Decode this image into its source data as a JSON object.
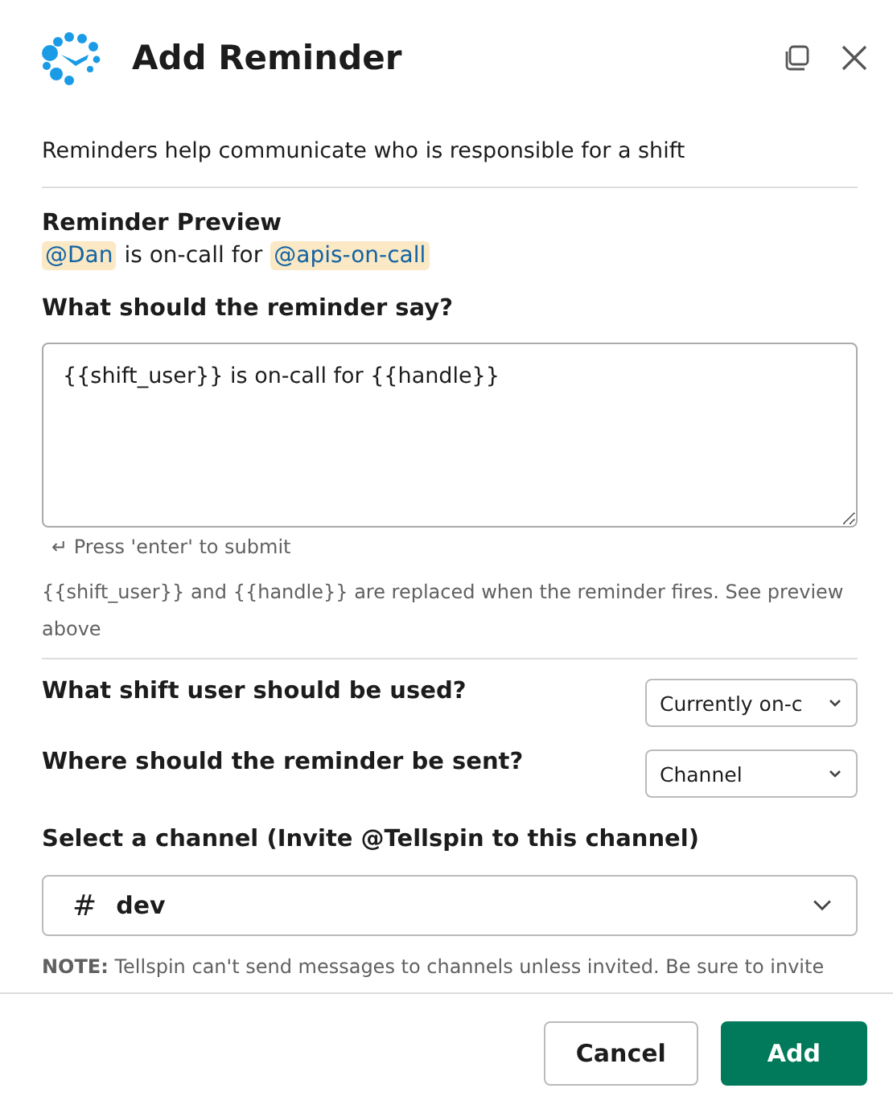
{
  "dialog": {
    "title": "Add Reminder"
  },
  "intro": "Reminders help communicate who is responsible for a shift",
  "preview": {
    "label": "Reminder Preview",
    "parts": [
      {
        "kind": "mention",
        "text": "@Dan"
      },
      {
        "kind": "text",
        "text": "is on-call for"
      },
      {
        "kind": "mention",
        "text": "@apis-on-call"
      }
    ]
  },
  "message": {
    "label": "What should the reminder say?",
    "value": "{{shift_user}} is on-call for {{handle}}",
    "hint": "↵ Press 'enter' to submit",
    "help": "{{shift_user}} and {{handle}} are replaced when the reminder fires. See preview above"
  },
  "selects": [
    {
      "label": "What shift user should be used?",
      "value": "Currently on-c"
    },
    {
      "label": "Where should the reminder be sent?",
      "value": "Channel"
    }
  ],
  "channel": {
    "label": "Select a channel (Invite @Tellspin to this channel)",
    "prefix": "#",
    "value": "dev",
    "note": "**NOTE:** Tellspin can't send messages to channels unless invited. Be sure to invite"
  },
  "buttons": [
    {
      "label": "Cancel",
      "kind": "secondary"
    },
    {
      "label": "Add",
      "kind": "primary"
    }
  ]
}
